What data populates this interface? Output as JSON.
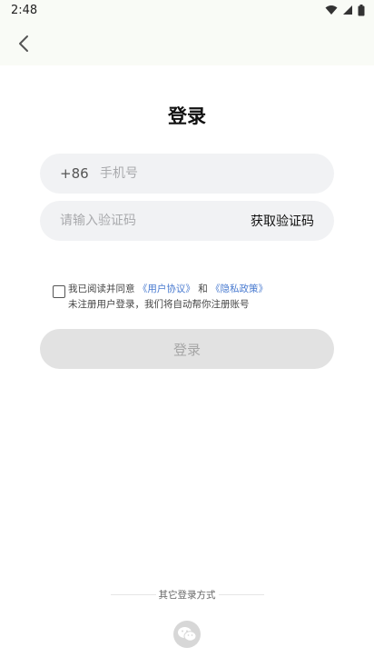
{
  "status_bar": {
    "time": "2:48",
    "icons": [
      "wifi-icon",
      "signal-icon",
      "battery-icon"
    ]
  },
  "app_bar": {
    "back_icon": "chevron-left-icon"
  },
  "page": {
    "title": "登录"
  },
  "phone_field": {
    "country_code": "+86",
    "placeholder": "手机号",
    "value": ""
  },
  "code_field": {
    "placeholder": "请输入验证码",
    "value": "",
    "get_code_label": "获取验证码"
  },
  "agreement": {
    "checked": false,
    "prefix": "我已阅读并同意",
    "user_agreement": "《用户协议》",
    "and": "和",
    "privacy_policy": "《隐私政策》",
    "note": "未注册用户登录，我们将自动帮你注册账号"
  },
  "login_button": {
    "label": "登录"
  },
  "other_login": {
    "label": "其它登录方式",
    "options": [
      "wechat-icon"
    ]
  },
  "colors": {
    "link": "#4a7bd0",
    "field_bg": "#f1f2f4",
    "button_disabled_bg": "#e2e2e2",
    "button_disabled_text": "#a6a6a6",
    "header_bg": "#f9fbf6"
  }
}
